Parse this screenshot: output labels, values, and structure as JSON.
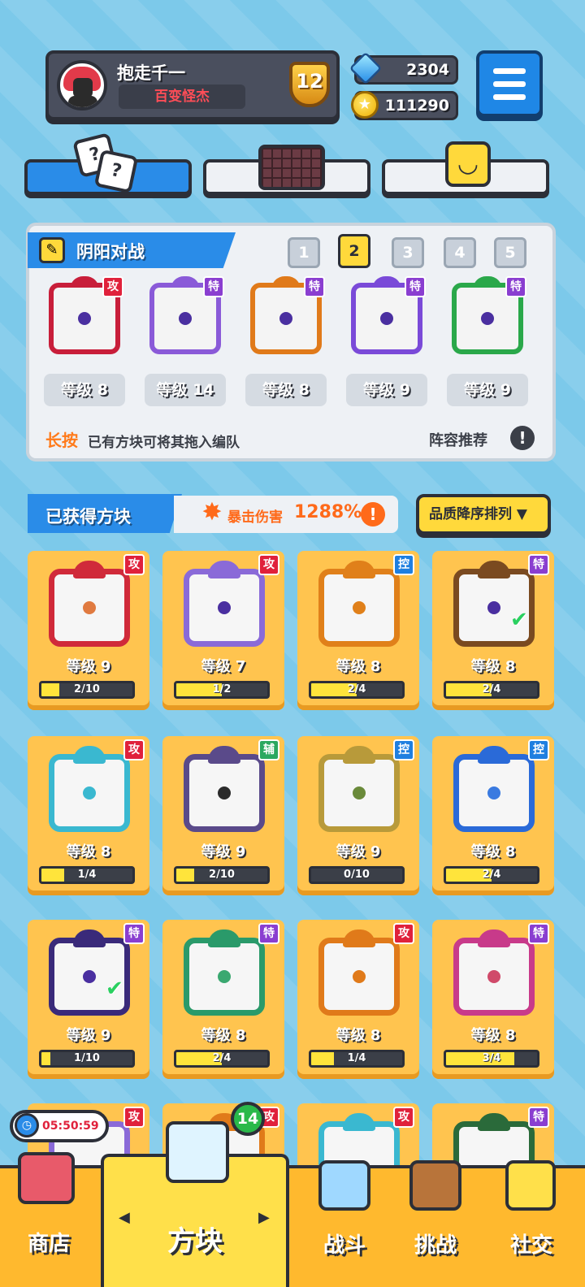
{
  "player": {
    "name": "抱走千一",
    "title": "百变怪杰",
    "rank": "12"
  },
  "currency": {
    "gems": "2304",
    "coins": "111290"
  },
  "colors": {
    "accent_blue": "#2a8ce8",
    "card_gold": "#ffc44f",
    "progress_yellow": "#ffe43b",
    "attack_red": "#e0213b",
    "special_purple": "#8a3ed0",
    "control_blue": "#1f7fe0",
    "support_green": "#2aa860"
  },
  "team": {
    "title": "阴阳对战",
    "pages": [
      "1",
      "2",
      "3",
      "4",
      "5"
    ],
    "active_page": "2",
    "slots": [
      {
        "type": "攻",
        "level": "等级 8",
        "color": "#c81e3a"
      },
      {
        "type": "特",
        "level": "等级 14",
        "color": "#8a5ad8"
      },
      {
        "type": "特",
        "level": "等级 8",
        "color": "#e07a1a"
      },
      {
        "type": "特",
        "level": "等级 9",
        "color": "#7a4ad8"
      },
      {
        "type": "特",
        "level": "等级 9",
        "color": "#2aa84a"
      }
    ],
    "hint_highlight": "长按",
    "hint_text": "已有方块可将其拖入编队",
    "recommend_label": "阵容推荐",
    "info_mark": "!"
  },
  "owned": {
    "title": "已获得方块",
    "crit_label": "暴击伤害",
    "crit_value": "1288%",
    "sort_label": "品质降序排列",
    "sort_arrow": "▼",
    "cards": [
      {
        "type": "攻",
        "level": "等级 9",
        "progress": "2/10",
        "fraction": 0.2,
        "color": "#d02a3a",
        "core": "#e07a40",
        "selected": false
      },
      {
        "type": "攻",
        "level": "等级 7",
        "progress": "1/2",
        "fraction": 0.5,
        "color": "#8a6ad8",
        "core": "#4a2fa0",
        "selected": false
      },
      {
        "type": "控",
        "level": "等级 8",
        "progress": "2/4",
        "fraction": 0.5,
        "color": "#e0801a",
        "core": "#e0801a",
        "selected": false
      },
      {
        "type": "特",
        "level": "等级 8",
        "progress": "2/4",
        "fraction": 0.5,
        "color": "#7a4a20",
        "core": "#4a2fa0",
        "selected": true
      },
      {
        "type": "攻",
        "level": "等级 8",
        "progress": "1/4",
        "fraction": 0.25,
        "color": "#3ab8d0",
        "core": "#3ab8d0",
        "selected": false
      },
      {
        "type": "辅",
        "level": "等级 9",
        "progress": "2/10",
        "fraction": 0.2,
        "color": "#5a4a8a",
        "core": "#2b2b2b",
        "selected": false
      },
      {
        "type": "控",
        "level": "等级 9",
        "progress": "0/10",
        "fraction": 0.0,
        "color": "#b89a3a",
        "core": "#6a8a3a",
        "selected": false
      },
      {
        "type": "控",
        "level": "等级 8",
        "progress": "2/4",
        "fraction": 0.5,
        "color": "#2a6ad8",
        "core": "#3a7ae0",
        "selected": false
      },
      {
        "type": "特",
        "level": "等级 9",
        "progress": "1/10",
        "fraction": 0.1,
        "color": "#3a2a7a",
        "core": "#4a2fa0",
        "selected": true
      },
      {
        "type": "特",
        "level": "等级 8",
        "progress": "2/4",
        "fraction": 0.5,
        "color": "#2a9a6a",
        "core": "#3aa870",
        "selected": false
      },
      {
        "type": "攻",
        "level": "等级 8",
        "progress": "1/4",
        "fraction": 0.25,
        "color": "#e07a1a",
        "core": "#e07a1a",
        "selected": false
      },
      {
        "type": "特",
        "level": "等级 8",
        "progress": "3/4",
        "fraction": 0.75,
        "color": "#c83a8a",
        "core": "#d04a6a",
        "selected": false
      },
      {
        "type": "攻",
        "color": "#8a6ad8"
      },
      {
        "type": "攻",
        "color": "#e07a1a"
      },
      {
        "type": "攻",
        "color": "#3ab8d0"
      },
      {
        "type": "特",
        "color": "#2a6a3a"
      }
    ]
  },
  "nav": {
    "shop": "商店",
    "blocks": "方块",
    "battle": "战斗",
    "challenge": "挑战",
    "social": "社交",
    "timer": "05:50:59",
    "block_count": "14",
    "arrow_left": "◀",
    "arrow_right": "▶"
  }
}
